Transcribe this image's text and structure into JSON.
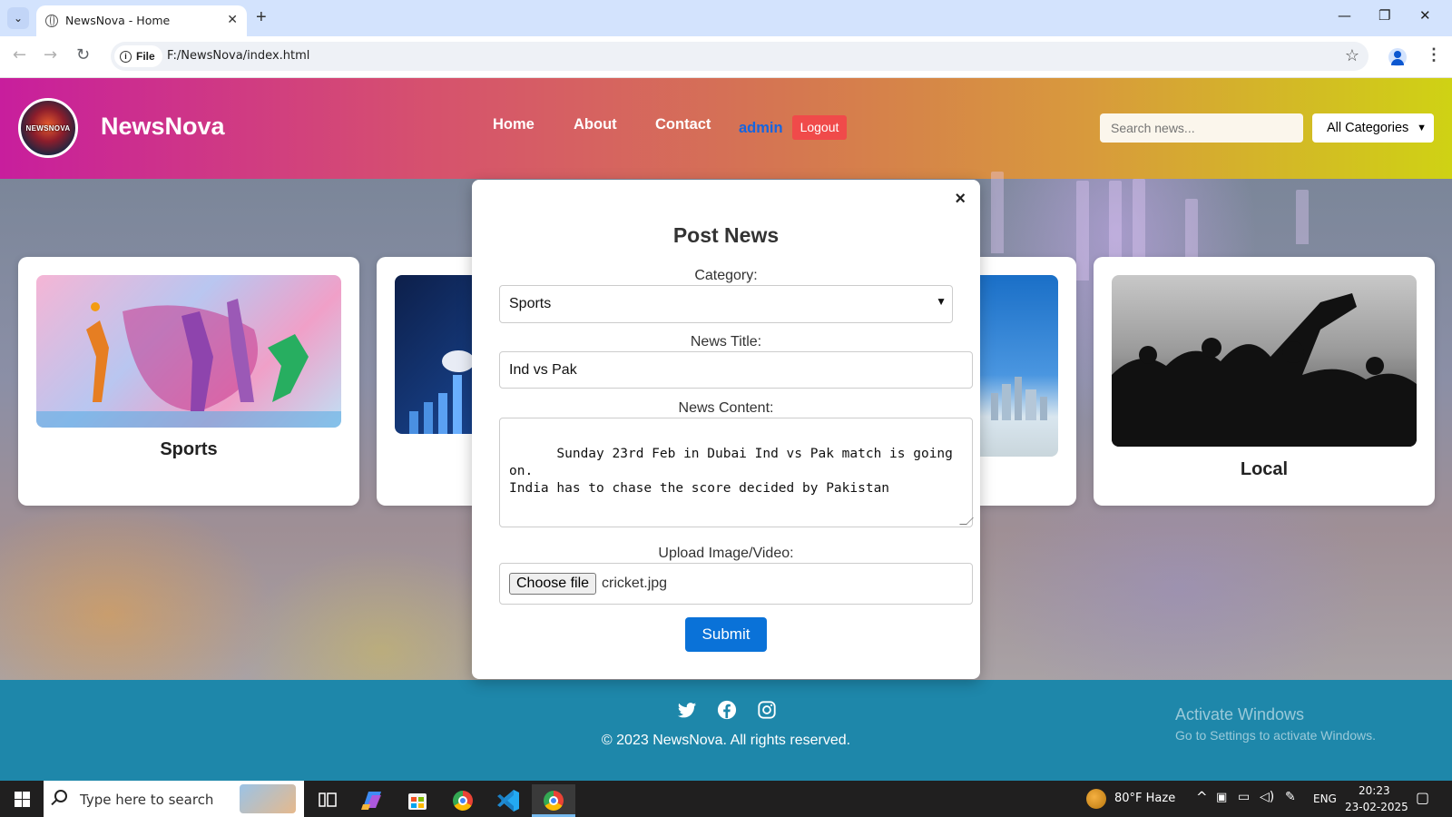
{
  "browser": {
    "tab_title": "NewsNova - Home",
    "site_chip": "File",
    "url": "F:/NewsNova/index.html"
  },
  "header": {
    "logo_text": "NEWSNOVA",
    "brand": "NewsNova",
    "nav": [
      "Home",
      "About",
      "Contact"
    ],
    "admin": "admin",
    "logout": "Logout",
    "search_placeholder": "Search news...",
    "category_selected": "All Categories"
  },
  "cards": [
    {
      "label": "Sports"
    },
    {
      "label": "Local"
    }
  ],
  "modal": {
    "close": "×",
    "title": "Post News",
    "category_label": "Category:",
    "category_value": "Sports",
    "title_label": "News Title:",
    "title_value": "Ind vs Pak",
    "content_label": "News Content:",
    "content_value": "Sunday 23rd Feb in Dubai Ind vs Pak match is going on.\nIndia has to chase the score decided by Pakistan",
    "upload_label": "Upload Image/Video:",
    "choose_file": "Choose file",
    "file_name": "cricket.jpg",
    "submit": "Submit"
  },
  "footer": {
    "copyright": "© 2023 NewsNova. All rights reserved.",
    "activate_title": "Activate Windows",
    "activate_sub": "Go to Settings to activate Windows."
  },
  "taskbar": {
    "search_placeholder": "Type here to search",
    "weather": "80°F  Haze",
    "language": "ENG",
    "time": "20:23",
    "date": "23-02-2025"
  }
}
